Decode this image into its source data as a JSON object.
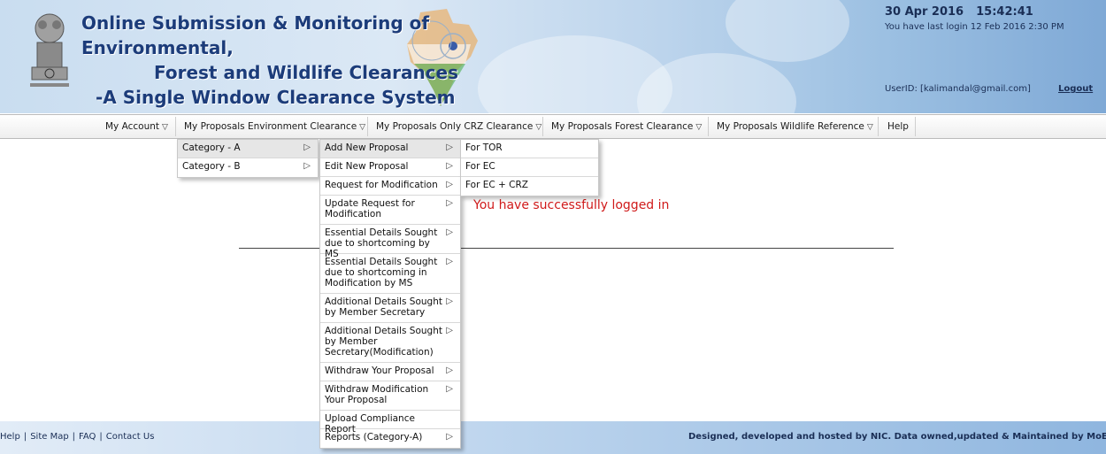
{
  "header": {
    "title_line1": "Online Submission & Monitoring of Environmental,",
    "title_line2": "Forest and Wildlife Clearances",
    "title_line3": "-A Single Window Clearance System",
    "date": "30 Apr 2016",
    "time": "15:42:41",
    "last_login": "You have last login 12 Feb 2016 2:30 PM",
    "user_id": "UserID: [kalimandal@gmail.com]",
    "logout": "Logout"
  },
  "nav": {
    "items": [
      {
        "label": "My Account"
      },
      {
        "label": "My Proposals Environment Clearance"
      },
      {
        "label": "My Proposals Only CRZ Clearance"
      },
      {
        "label": "My Proposals Forest Clearance"
      },
      {
        "label": "My Proposals Wildlife Reference"
      },
      {
        "label": "Help"
      }
    ],
    "arrow_glyph": "▽"
  },
  "menus": {
    "category": [
      "Category - A",
      "Category - B"
    ],
    "proposal": [
      "Add New Proposal",
      "Edit New Proposal",
      "Request for Modification",
      "Update Request for Modification",
      "Essential Details Sought due to shortcoming by MS",
      "Essential Details Sought due to shortcoming in Modification by MS",
      "Additional Details Sought by Member Secretary",
      "Additional Details Sought by Member Secretary(Modification)",
      "Withdraw Your Proposal",
      "Withdraw Modification Your Proposal",
      "Upload Compliance Report",
      "Reports (Category-A)"
    ],
    "type": [
      "For TOR",
      "For EC",
      "For EC + CRZ"
    ],
    "submenu_glyph": "▷"
  },
  "main": {
    "success_message": "You have successfully logged in"
  },
  "footer": {
    "links": [
      "Help",
      "Site Map",
      "FAQ",
      "Contact Us"
    ],
    "link_separator": "|",
    "credit": "Designed, developed and hosted by NIC. Data owned,updated & Maintained by MoEFCC"
  },
  "colors": {
    "title_blue": "#1c3c7a",
    "success_red": "#d01a1a",
    "footer_blue": "#8fb6df"
  }
}
